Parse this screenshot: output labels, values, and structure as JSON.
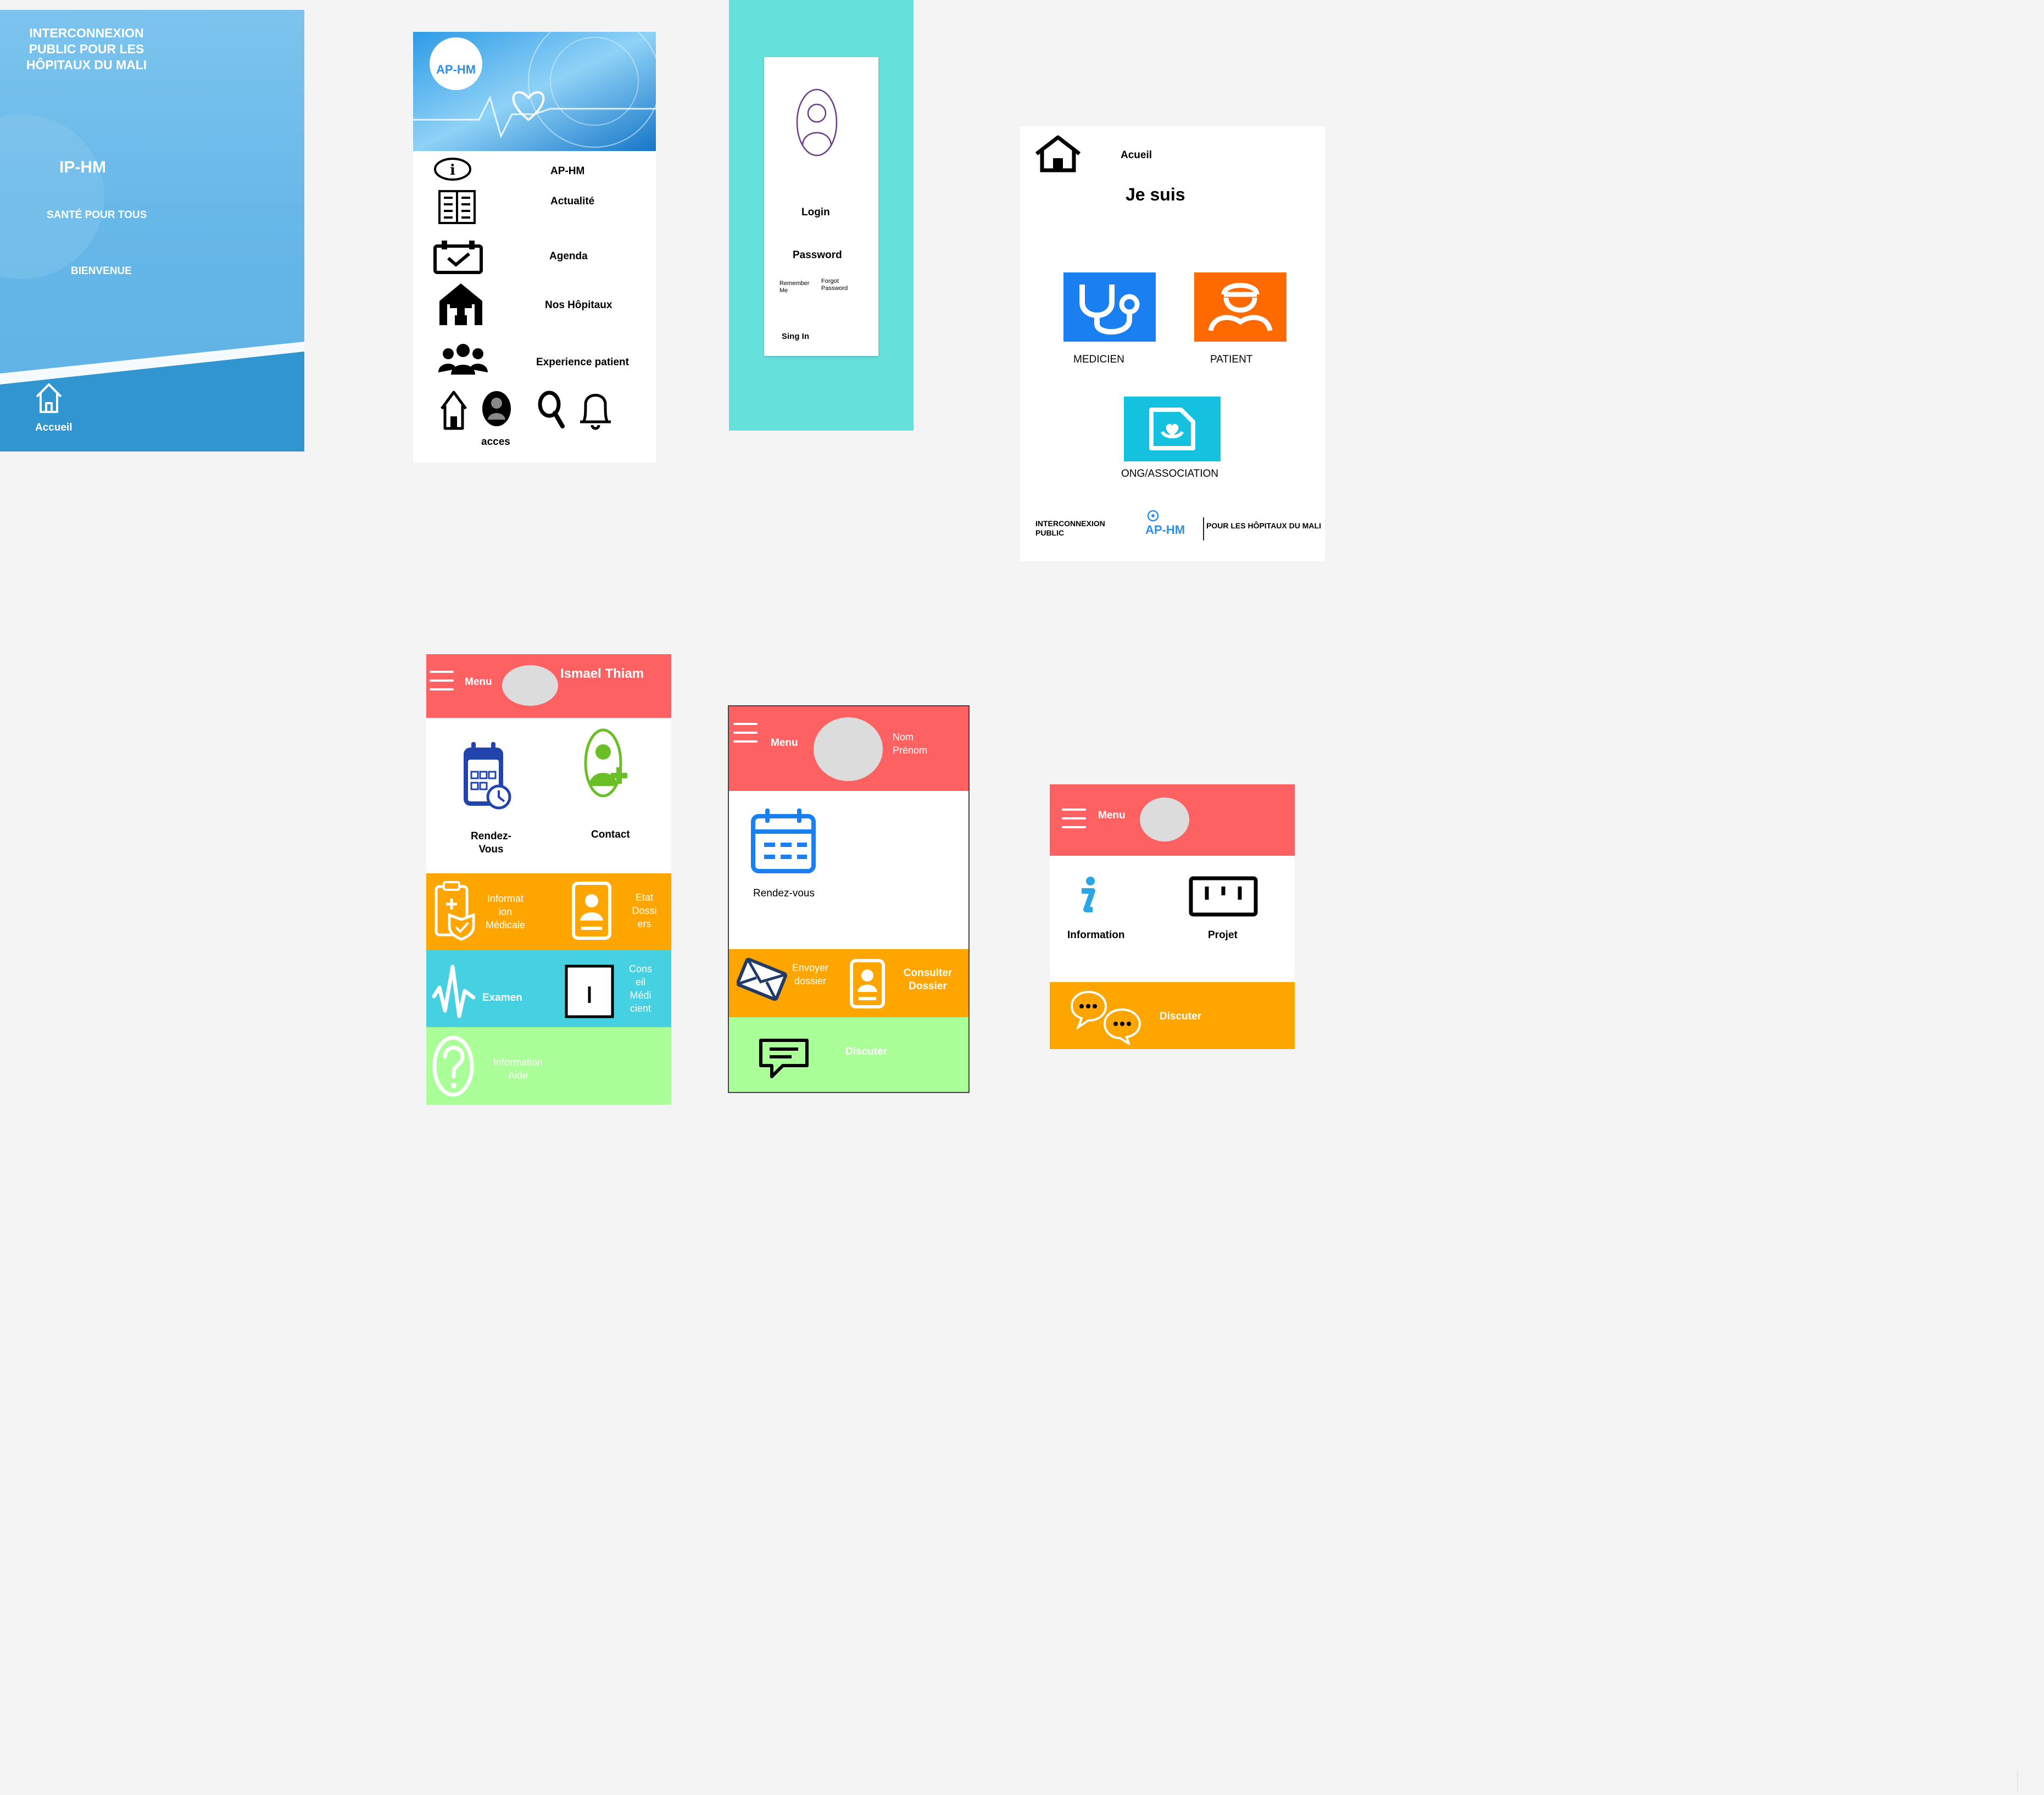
{
  "colors": {
    "canvas": "#f4f4f4",
    "teal": "#66e0da",
    "coral": "#fd6161",
    "orange": "#ffa500",
    "cyan": "#45d1e2",
    "green": "#aaff99",
    "med_blue": "#1a7ff0",
    "pat_orange": "#ff6a00",
    "ong_cyan": "#14c2df",
    "aphm_blue": "#2f8fe6"
  },
  "splash": {
    "title": "INTERCONNEXION PUBLIC POUR LES HÔPITAUX DU MALI",
    "abbr": "IP-HM",
    "slogan": "SANTÉ POUR TOUS",
    "welcome": "BIENVENUE",
    "home_label": "Accueil",
    "home_icon": "house-icon"
  },
  "menu_screen": {
    "logo": "AP-HM",
    "items": [
      {
        "icon": "info-icon",
        "label": "AP-HM"
      },
      {
        "icon": "newspaper-icon",
        "label": "Actualité"
      },
      {
        "icon": "calendar-check-icon",
        "label": "Agenda"
      },
      {
        "icon": "hospital-icon",
        "label": "Nos Hôpitaux"
      },
      {
        "icon": "group-icon",
        "label": "Experience patient"
      }
    ],
    "bottom": {
      "acces": "acces",
      "icons": [
        "house-icon",
        "user-icon",
        "search-icon",
        "bell-icon"
      ]
    }
  },
  "login_screen": {
    "login": "Login",
    "password": "Password",
    "remember": "Remember Me",
    "forgot": "Forgot Password",
    "signin": "Sing In"
  },
  "role_screen": {
    "home": "Acueil",
    "title": "Je suis",
    "roles": [
      {
        "label": "MEDICIEN",
        "icon": "stethoscope-icon"
      },
      {
        "label": "PATIENT",
        "icon": "nurse-icon"
      },
      {
        "label": "ONG/ASSOCIATION",
        "icon": "document-heart-icon"
      }
    ],
    "footer": {
      "left": "INTERCONNEXION PUBLIC",
      "logo": "AP-HM",
      "right": "POUR LES HÔPITAUX DU MALI"
    }
  },
  "patient_dash": {
    "menu": "Menu",
    "user": "Ismael Thiam",
    "tiles": [
      {
        "label": "Rendez-Vous",
        "icon": "calendar-clock-icon"
      },
      {
        "label": "Contact",
        "icon": "doctor-plus-icon"
      },
      {
        "label": "Informat ion Médicale",
        "icon": "clipboard-shield-icon"
      },
      {
        "label": "Etat Dossi ers",
        "icon": "id-badge-icon"
      },
      {
        "label": "Examen",
        "icon": "pulse-icon"
      },
      {
        "label": "Cons eil Médi cient",
        "icon": "frame-icon"
      },
      {
        "label": "Information Aide",
        "icon": "help-icon"
      }
    ]
  },
  "doctor_dash": {
    "menu": "Menu",
    "name": "Nom Prénom",
    "tiles": [
      {
        "label": "Rendez-vous",
        "icon": "calendar-icon"
      },
      {
        "label": "Envoyer dossier",
        "icon": "envelope-icon"
      },
      {
        "label": "Consulter Dossier",
        "icon": "id-badge-icon"
      },
      {
        "label": "Discuter",
        "icon": "chat-icon"
      }
    ]
  },
  "ong_dash": {
    "menu": "Menu",
    "tiles": [
      {
        "label": "Information",
        "icon": "italic-info-icon"
      },
      {
        "label": "Projet",
        "icon": "chart-box-icon"
      },
      {
        "label": "Discuter",
        "icon": "chat-bubbles-icon"
      }
    ]
  }
}
